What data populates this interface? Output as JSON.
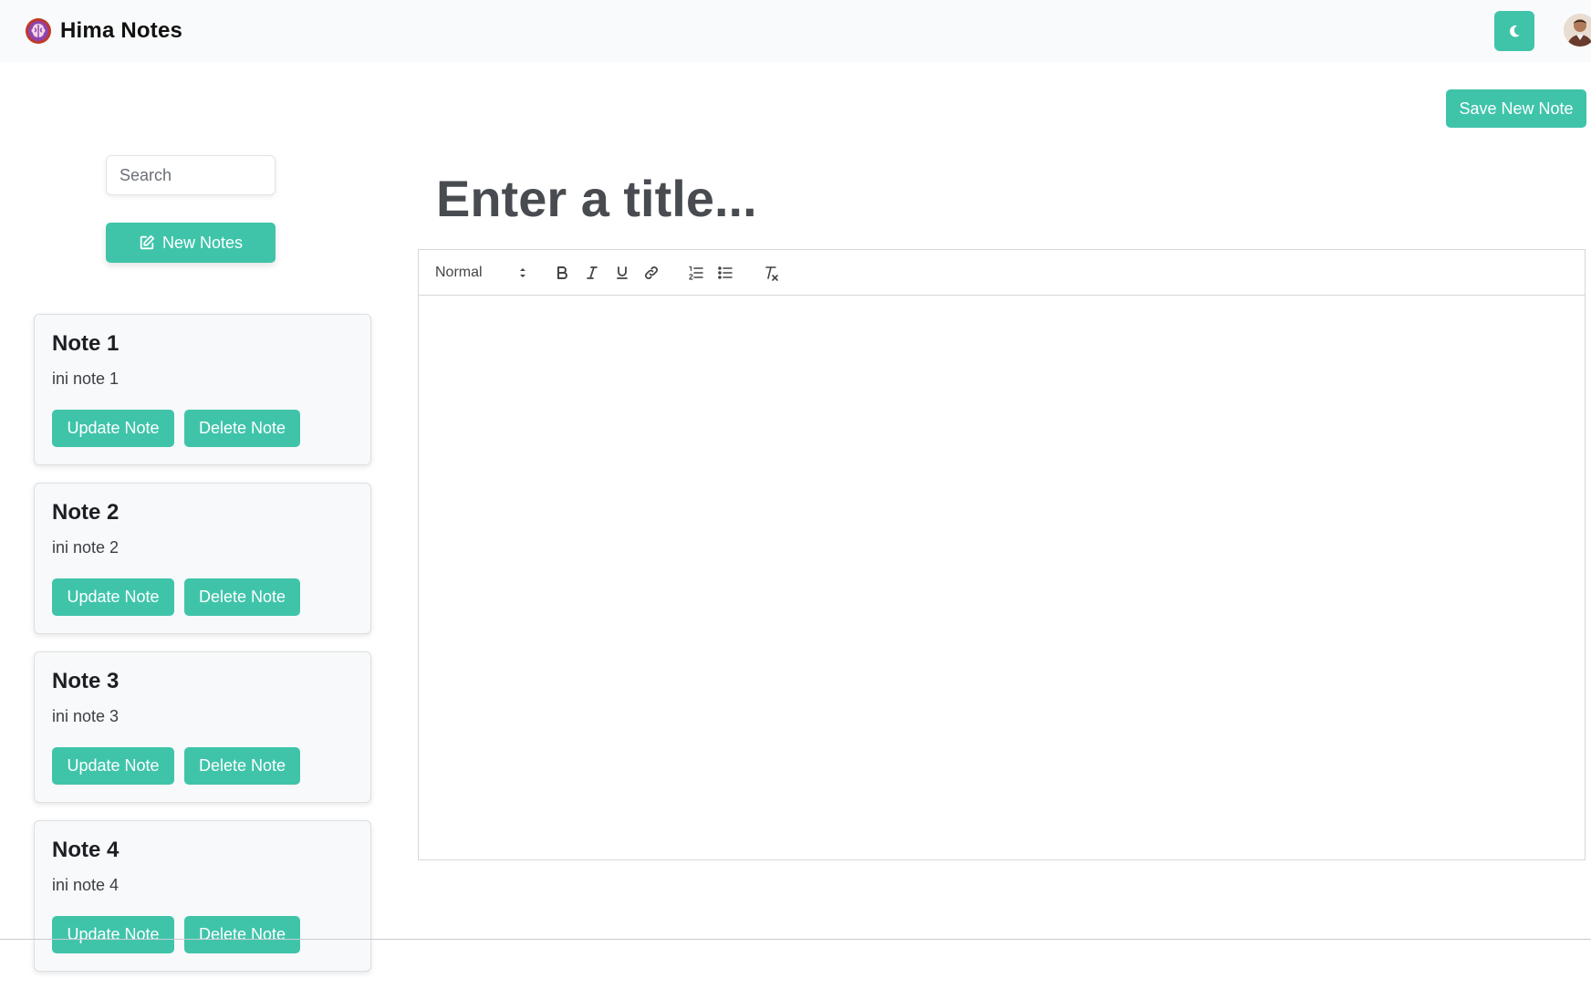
{
  "navbar": {
    "brand_name": "Hima Notes",
    "logo_icon": "brain-logo-icon",
    "theme_toggle_icon": "moon-icon",
    "avatar_icon": "user-avatar"
  },
  "actions": {
    "save_label": "Save New Note"
  },
  "sidebar": {
    "search_placeholder": "Search",
    "new_notes_label": "New Notes",
    "new_notes_icon": "edit-icon",
    "notes": [
      {
        "title": "Note 1",
        "body": "ini note 1",
        "update_label": "Update Note",
        "delete_label": "Delete Note"
      },
      {
        "title": "Note 2",
        "body": "ini note 2",
        "update_label": "Update Note",
        "delete_label": "Delete Note"
      },
      {
        "title": "Note 3",
        "body": "ini note 3",
        "update_label": "Update Note",
        "delete_label": "Delete Note"
      },
      {
        "title": "Note 4",
        "body": "ini note 4",
        "update_label": "Update Note",
        "delete_label": "Delete Note"
      }
    ]
  },
  "editor": {
    "title_placeholder": "Enter a title...",
    "format_value": "Normal",
    "toolbar_icons": [
      "bold-icon",
      "italic-icon",
      "underline-icon",
      "link-icon",
      "ordered-list-icon",
      "bullet-list-icon",
      "clear-format-icon"
    ],
    "body_text": ""
  },
  "colors": {
    "accent": "#3fc4aa",
    "navbar_bg": "#f9fafb",
    "card_bg": "#f8f9fa"
  }
}
